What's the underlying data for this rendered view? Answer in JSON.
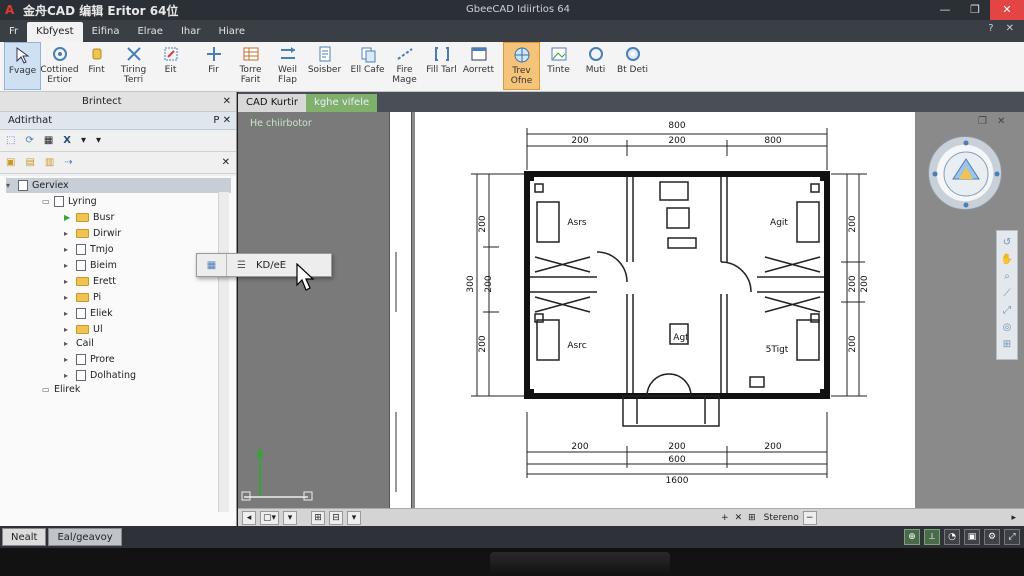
{
  "window": {
    "title_left": "金舟CAD 编辑 Eritor 64位",
    "title_center": "GbeeCAD Idiirtios 64",
    "min": "—",
    "max": "❐",
    "close": "✕"
  },
  "tabs": [
    {
      "label": "Fr"
    },
    {
      "label": "Kbfyest",
      "active": true
    },
    {
      "label": "Eifina"
    },
    {
      "label": "Elrae"
    },
    {
      "label": "Ihar"
    },
    {
      "label": "Hiare"
    }
  ],
  "tab_right": {
    "question": "?",
    "close": "✕"
  },
  "ribbon": [
    {
      "label": "Fvage",
      "icon": "pointer-icon",
      "sel": true
    },
    {
      "label": "Cottined Ertior",
      "icon": "gear-icon"
    },
    {
      "label": "Fint",
      "icon": "hand-icon"
    },
    {
      "label": "Tiring Terri",
      "icon": "transform-icon"
    },
    {
      "label": "Eit",
      "icon": "scale-icon"
    },
    {
      "label": "Fir",
      "icon": "move-icon"
    },
    {
      "label": "Torre Farit",
      "icon": "table-icon"
    },
    {
      "label": "Weil Flap",
      "icon": "arrows-icon"
    },
    {
      "label": "Soisber",
      "icon": "doc-icon"
    },
    {
      "label": "Ell Cafe",
      "icon": "copy-icon"
    },
    {
      "label": "Fire Mage",
      "icon": "dash-icon"
    },
    {
      "label": "Fill Tarl",
      "icon": "bracket-icon"
    },
    {
      "label": "Aorrett",
      "icon": "window-icon"
    },
    {
      "label": "Trev Ofne",
      "icon": "globe-icon",
      "hl": true
    },
    {
      "label": "Tinte",
      "icon": "image-icon"
    },
    {
      "label": "Muti",
      "icon": "ring-icon"
    },
    {
      "label": "Bt Deti",
      "icon": "gear2-icon"
    }
  ],
  "panel": {
    "title": "Brintect",
    "sub_title": "Adtirthat",
    "sub_ctl": "P ✕"
  },
  "tree": [
    {
      "label": "Gerviex",
      "depth": 0,
      "kind": "file",
      "sel": true
    },
    {
      "label": "Lyring",
      "depth": 1,
      "kind": "file",
      "open": true
    },
    {
      "label": "Busr",
      "depth": 2,
      "kind": "folder",
      "green": true
    },
    {
      "label": "Dirwir",
      "depth": 2,
      "kind": "folder"
    },
    {
      "label": "Tmjo",
      "depth": 2,
      "kind": "file"
    },
    {
      "label": "Bieim",
      "depth": 2,
      "kind": "file"
    },
    {
      "label": "Erett",
      "depth": 2,
      "kind": "folder"
    },
    {
      "label": "Pi",
      "depth": 2,
      "kind": "folder"
    },
    {
      "label": "Eliek",
      "depth": 2,
      "kind": "file"
    },
    {
      "label": "Ul",
      "depth": 2,
      "kind": "folder"
    },
    {
      "label": "Cail",
      "depth": 2,
      "kind": "none"
    },
    {
      "label": "Prore",
      "depth": 2,
      "kind": "file"
    },
    {
      "label": "Dolhating",
      "depth": 2,
      "kind": "file"
    },
    {
      "label": "Elirek",
      "depth": 1,
      "kind": "none"
    }
  ],
  "popup": {
    "label": "KD/eE"
  },
  "doc_tabs": [
    "CAD Kurtir",
    "kghe vifele"
  ],
  "mid_label": "He chiirbotor",
  "drawing": {
    "top": {
      "total": "800",
      "a": "200",
      "b": "200",
      "c": "800"
    },
    "bottom": {
      "a": "200",
      "b": "200",
      "c": "200",
      "d": "600",
      "e": "1600"
    },
    "left": {
      "a": "200",
      "b": "300",
      "c": "200",
      "d": "200",
      "e": "200"
    },
    "right": {
      "a": "200",
      "b": "200",
      "c": "200",
      "d": "200"
    },
    "rooms": [
      {
        "label": "Asrs"
      },
      {
        "label": "Asrc"
      },
      {
        "label": "Agt"
      },
      {
        "label": "Agit"
      },
      {
        "label": "5Tigt"
      }
    ]
  },
  "bottom_tools": {
    "label": "Stereno"
  },
  "status": {
    "tab1": "Nealt",
    "tab2": "Eal/geavoy"
  }
}
